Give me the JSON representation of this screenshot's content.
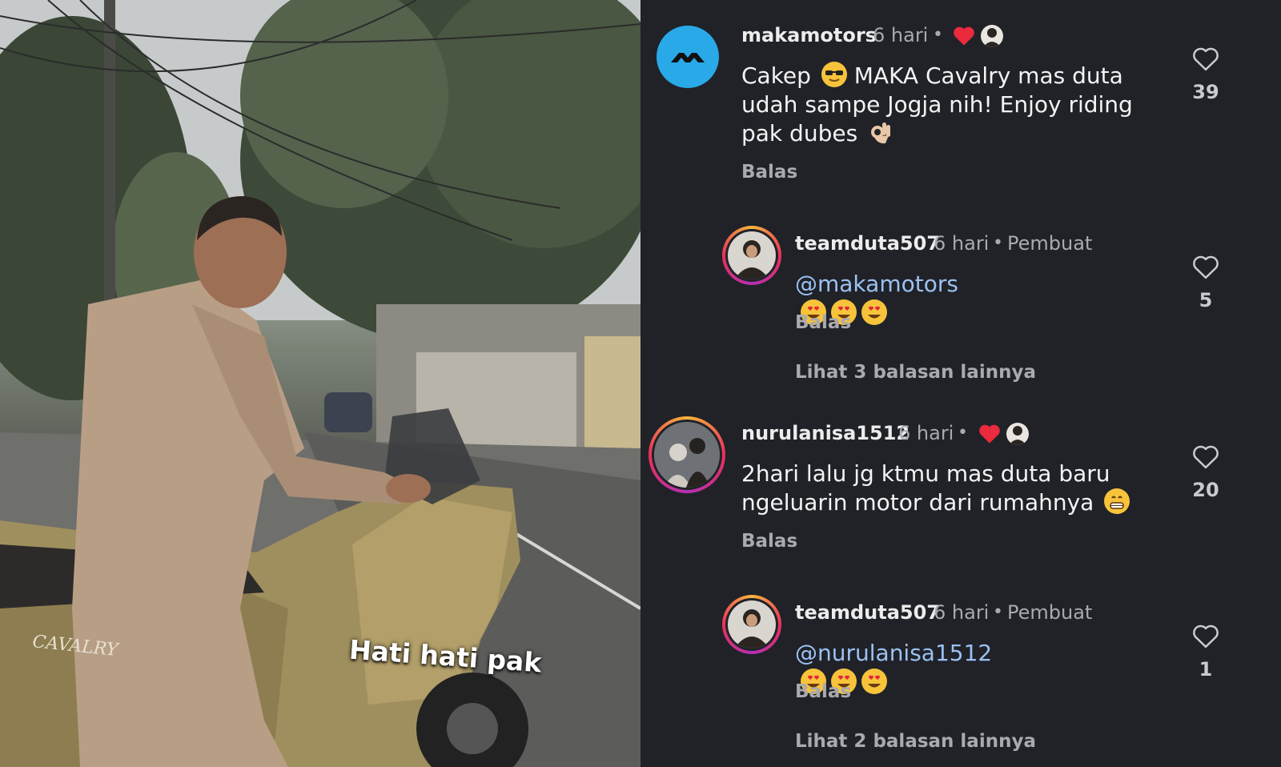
{
  "photo": {
    "caption": "Hati hati pak",
    "scooter_brand": "CAVALRY"
  },
  "comments": [
    {
      "username": "makamotors",
      "time": "6 hari",
      "text": "Cakep 😎 MAKA Cavalry mas duta udah sampe Jogja nih! Enjoy riding pak dubes 👌🏼",
      "text_lines": [
        "Cakep",
        "MAKA Cavalry mas duta",
        "udah sampe Jogja nih! Enjoy riding",
        "pak dubes"
      ],
      "reply_label": "Balas",
      "likes": "39",
      "liked_by_creator": true,
      "avatar_icon": "maka-logo-icon"
    },
    {
      "username": "teamduta507",
      "time": "6 hari",
      "creator_label": "Pembuat",
      "mention": "@makamotors",
      "reply_label": "Balas",
      "likes": "5",
      "view_more": "Lihat 3 balasan lainnya"
    },
    {
      "username": "nurulanisa1512",
      "time": "6 hari",
      "text_lines": [
        "2hari lalu jg ktmu mas duta baru",
        "ngeluarin motor dari rumahnya"
      ],
      "reply_label": "Balas",
      "likes": "20",
      "liked_by_creator": true
    },
    {
      "username": "teamduta507",
      "time": "6 hari",
      "creator_label": "Pembuat",
      "mention": "@nurulanisa1512",
      "reply_label": "Balas",
      "likes": "1",
      "view_more": "Lihat 2 balasan lainnya"
    }
  ],
  "colors": {
    "background": "#202228",
    "mention": "#9cc1f2",
    "heart_red": "#ea2a3d",
    "maka_brand": "#29a9e8"
  }
}
